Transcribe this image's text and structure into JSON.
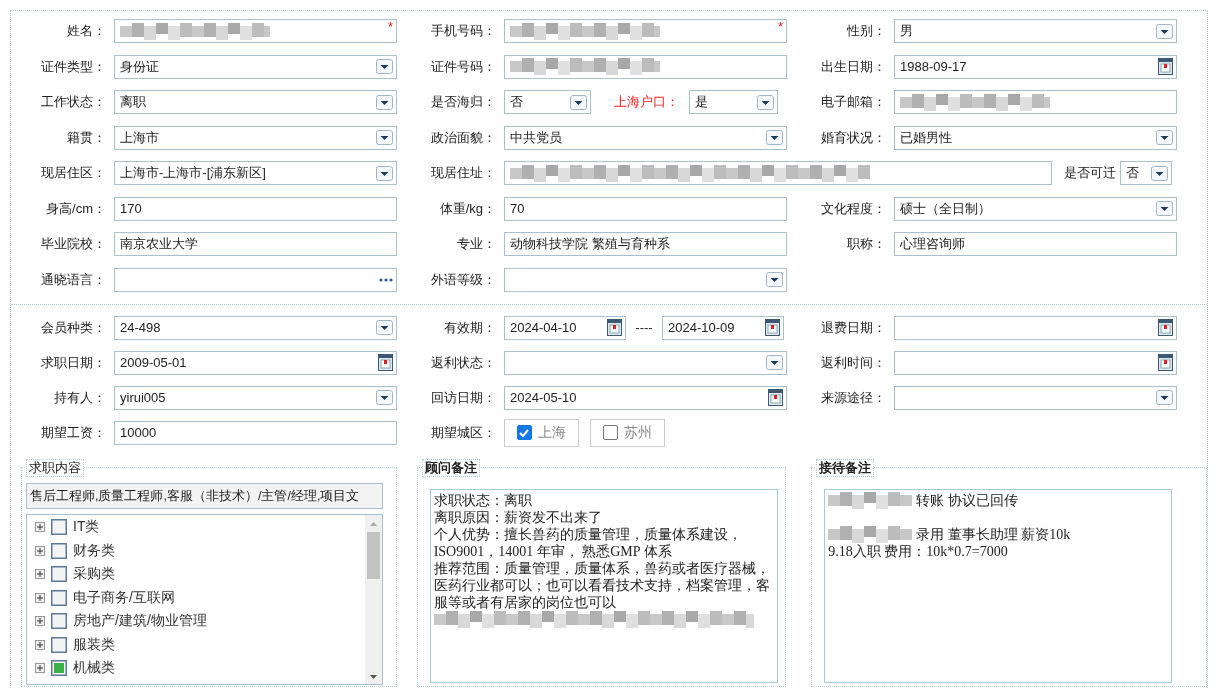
{
  "profile_rows": [
    [
      {
        "kind": "blurred-required",
        "label": "姓名：",
        "required_mark": "*"
      },
      {
        "kind": "blurred-required",
        "label": "手机号码：",
        "required_mark": "*"
      },
      {
        "kind": "select",
        "label": "性别：",
        "value": "男"
      }
    ],
    [
      {
        "kind": "select",
        "label": "证件类型：",
        "value": "身份证"
      },
      {
        "kind": "blurred",
        "label": "证件号码："
      },
      {
        "kind": "date",
        "label": "出生日期：",
        "value": "1988-09-17"
      }
    ],
    [
      {
        "kind": "select",
        "label": "工作状态：",
        "value": "离职"
      },
      {
        "kind": "pair",
        "label": "是否海归：",
        "value": "否",
        "second_label": "上海户口：",
        "second_value": "是"
      },
      {
        "kind": "blurred",
        "label": "电子邮箱："
      }
    ],
    [
      {
        "kind": "select",
        "label": "籍贯：",
        "value": "上海市"
      },
      {
        "kind": "select",
        "label": "政治面貌：",
        "value": "中共党员"
      },
      {
        "kind": "select",
        "label": "婚育状况：",
        "value": "已婚男性"
      }
    ],
    [
      {
        "kind": "select",
        "label": "现居住区：",
        "value": "上海市-上海市-[浦东新区]"
      },
      {
        "kind": "address",
        "label": "现居住址：",
        "extra_label": "是否可迁",
        "extra_value": "否"
      }
    ],
    [
      {
        "kind": "text",
        "label": "身高/cm：",
        "value": "170"
      },
      {
        "kind": "text",
        "label": "体重/kg：",
        "value": "70"
      },
      {
        "kind": "select",
        "label": "文化程度：",
        "value": "硕士（全日制）"
      }
    ],
    [
      {
        "kind": "text",
        "label": "毕业院校：",
        "value": "南京农业大学"
      },
      {
        "kind": "text",
        "label": "专业：",
        "value": "动物科技学院 繁殖与育种系"
      },
      {
        "kind": "text",
        "label": "职称：",
        "value": "心理咨询师"
      }
    ],
    [
      {
        "kind": "more",
        "label": "通晓语言："
      },
      {
        "kind": "select",
        "label": "外语等级："
      }
    ]
  ],
  "membership_rows": [
    [
      {
        "kind": "select",
        "label": "会员种类：",
        "value": "24-498"
      },
      {
        "kind": "range",
        "label": "有效期：",
        "from": "2024-04-10",
        "separator": "----",
        "to": "2024-10-09"
      },
      {
        "kind": "date",
        "label": "退费日期："
      }
    ],
    [
      {
        "kind": "date",
        "label": "求职日期：",
        "value": "2009-05-01"
      },
      {
        "kind": "select",
        "label": "返利状态："
      },
      {
        "kind": "date",
        "label": "返利时间："
      }
    ],
    [
      {
        "kind": "select",
        "label": "持有人：",
        "value": "yirui005"
      },
      {
        "kind": "date",
        "label": "回访日期：",
        "value": "2024-05-10"
      },
      {
        "kind": "select",
        "label": "来源途径："
      }
    ],
    [
      {
        "kind": "text",
        "label": "期望工资：",
        "value": "10000"
      },
      {
        "kind": "cities",
        "label": "期望城区：",
        "options": [
          {
            "label": "上海",
            "checked": true
          },
          {
            "label": "苏州",
            "checked": false
          }
        ]
      }
    ]
  ],
  "job_content": {
    "legend": "求职内容",
    "summary": "售后工程师,质量工程师,客服（非技术）/主管/经理,项目文",
    "tree": [
      {
        "label": "IT类",
        "expanded": false,
        "checked": false,
        "partial": false
      },
      {
        "label": "财务类",
        "expanded": false,
        "checked": false,
        "partial": false
      },
      {
        "label": "采购类",
        "expanded": false,
        "checked": false,
        "partial": false
      },
      {
        "label": "电子商务/互联网",
        "expanded": false,
        "checked": false,
        "partial": false
      },
      {
        "label": "房地产/建筑/物业管理",
        "expanded": false,
        "checked": false,
        "partial": false
      },
      {
        "label": "服装类",
        "expanded": false,
        "checked": false,
        "partial": false
      },
      {
        "label": "机械类",
        "expanded": false,
        "checked": false,
        "partial": true
      }
    ]
  },
  "advisor_notes": {
    "legend": "顾问备注",
    "lines": [
      {
        "kind": "text",
        "text": "求职状态：离职"
      },
      {
        "kind": "text",
        "text": "离职原因：薪资发不出来了"
      },
      {
        "kind": "text",
        "text": "个人优势：擅长兽药的质量管理，质量体系建设，"
      },
      {
        "kind": "text",
        "text": "ISO9001，14001 年审， 熟悉GMP 体系"
      },
      {
        "kind": "text",
        "text": "推荐范围：质量管理，质量体系，兽药或者医疗器械，"
      },
      {
        "kind": "text",
        "text": "医药行业都可以；也可以看看技术支持，档案管理，客"
      },
      {
        "kind": "text",
        "text": "服等或者有居家的岗位也可以"
      },
      {
        "kind": "blurred"
      }
    ]
  },
  "reception_notes": {
    "legend": "接待备注",
    "lines": [
      {
        "kind": "blurred-prefix",
        "text": "转账 协议已回传"
      },
      {
        "kind": "blank"
      },
      {
        "kind": "blurred-prefix",
        "text": "录用 董事长助理 薪资10k"
      },
      {
        "kind": "text",
        "text": "9.18入职 费用：10k*0.7=7000"
      }
    ]
  }
}
